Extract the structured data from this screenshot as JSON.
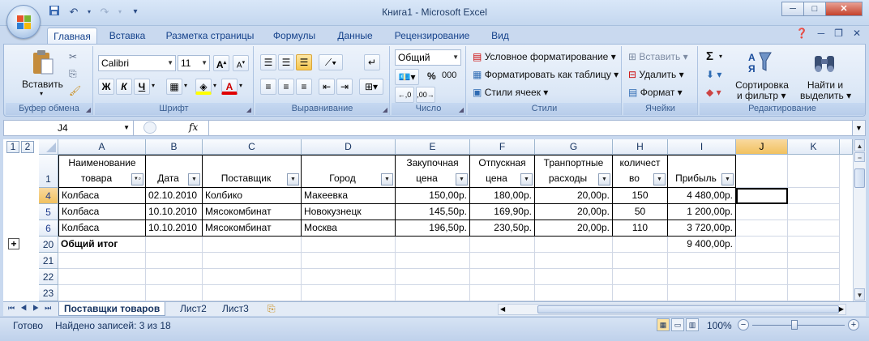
{
  "window": {
    "title": "Книга1 - Microsoft Excel",
    "minimize": "─",
    "maximize": "□",
    "close": "✕"
  },
  "ribbon_tabs": [
    "Главная",
    "Вставка",
    "Разметка страницы",
    "Формулы",
    "Данные",
    "Рецензирование",
    "Вид"
  ],
  "ribbon": {
    "clipboard": {
      "paste": "Вставить",
      "label": "Буфер обмена"
    },
    "font": {
      "name": "Calibri",
      "size": "11",
      "bold": "Ж",
      "italic": "К",
      "underline": "Ч",
      "label": "Шрифт"
    },
    "alignment": {
      "label": "Выравнивание"
    },
    "number": {
      "format": "Общий",
      "percent": "%",
      "thousands": "000",
      "label": "Число"
    },
    "styles": {
      "conditional": "Условное форматирование",
      "as_table": "Форматировать как таблицу",
      "cell_styles": "Стили ячеек",
      "label": "Стили"
    },
    "cells": {
      "insert": "Вставить",
      "delete": "Удалить",
      "format": "Формат",
      "label": "Ячейки"
    },
    "editing": {
      "sigma": "Σ",
      "sort_line1": "Сортировка",
      "sort_line2": "и фильтр",
      "find_line1": "Найти и",
      "find_line2": "выделить",
      "label": "Редактирование"
    }
  },
  "formula_bar": {
    "name_box": "J4",
    "fx": "fx",
    "value": ""
  },
  "outline_levels": [
    "1",
    "2"
  ],
  "columns": [
    "A",
    "B",
    "C",
    "D",
    "E",
    "F",
    "G",
    "H",
    "I",
    "J",
    "K"
  ],
  "header_row": {
    "row_num": "1",
    "cells": [
      {
        "l1": "Наименование",
        "l2": "товара"
      },
      {
        "l1": "",
        "l2": "Дата"
      },
      {
        "l1": "",
        "l2": "Поставщик"
      },
      {
        "l1": "",
        "l2": "Город"
      },
      {
        "l1": "Закупочная",
        "l2": "цена"
      },
      {
        "l1": "Отпускная",
        "l2": "цена"
      },
      {
        "l1": "Транпортные",
        "l2": "расходы"
      },
      {
        "l1": "количест",
        "l2": "во"
      },
      {
        "l1": "",
        "l2": "Прибыль"
      }
    ]
  },
  "rows": [
    {
      "num": "4",
      "cells": [
        "Колбаса",
        "02.10.2010",
        "Колбико",
        "Макеевка",
        "150,00р.",
        "180,00р.",
        "20,00р.",
        "150",
        "4 480,00р."
      ]
    },
    {
      "num": "5",
      "cells": [
        "Колбаса",
        "10.10.2010",
        "Мясокомбинат",
        "Новокузнецк",
        "145,50р.",
        "169,90р.",
        "20,00р.",
        "50",
        "1 200,00р."
      ]
    },
    {
      "num": "6",
      "cells": [
        "Колбаса",
        "10.10.2010",
        "Мясокомбинат",
        "Москва",
        "196,50р.",
        "230,50р.",
        "20,00р.",
        "110",
        "3 720,00р."
      ]
    },
    {
      "num": "20",
      "cells": [
        "Общий итог",
        "",
        "",
        "",
        "",
        "",
        "",
        "",
        "9 400,00р."
      ]
    },
    {
      "num": "21",
      "cells": [
        "",
        "",
        "",
        "",
        "",
        "",
        "",
        "",
        ""
      ]
    },
    {
      "num": "22",
      "cells": [
        "",
        "",
        "",
        "",
        "",
        "",
        "",
        "",
        ""
      ]
    },
    {
      "num": "23",
      "cells": [
        "",
        "",
        "",
        "",
        "",
        "",
        "",
        "",
        ""
      ]
    }
  ],
  "outline_expand": "+",
  "sheet_tabs": [
    "Поставщки товаров",
    "Лист2",
    "Лист3"
  ],
  "status": {
    "ready": "Готово",
    "filter_info": "Найдено записей: 3 из 18",
    "zoom": "100%",
    "zoom_minus": "−",
    "zoom_plus": "+"
  }
}
